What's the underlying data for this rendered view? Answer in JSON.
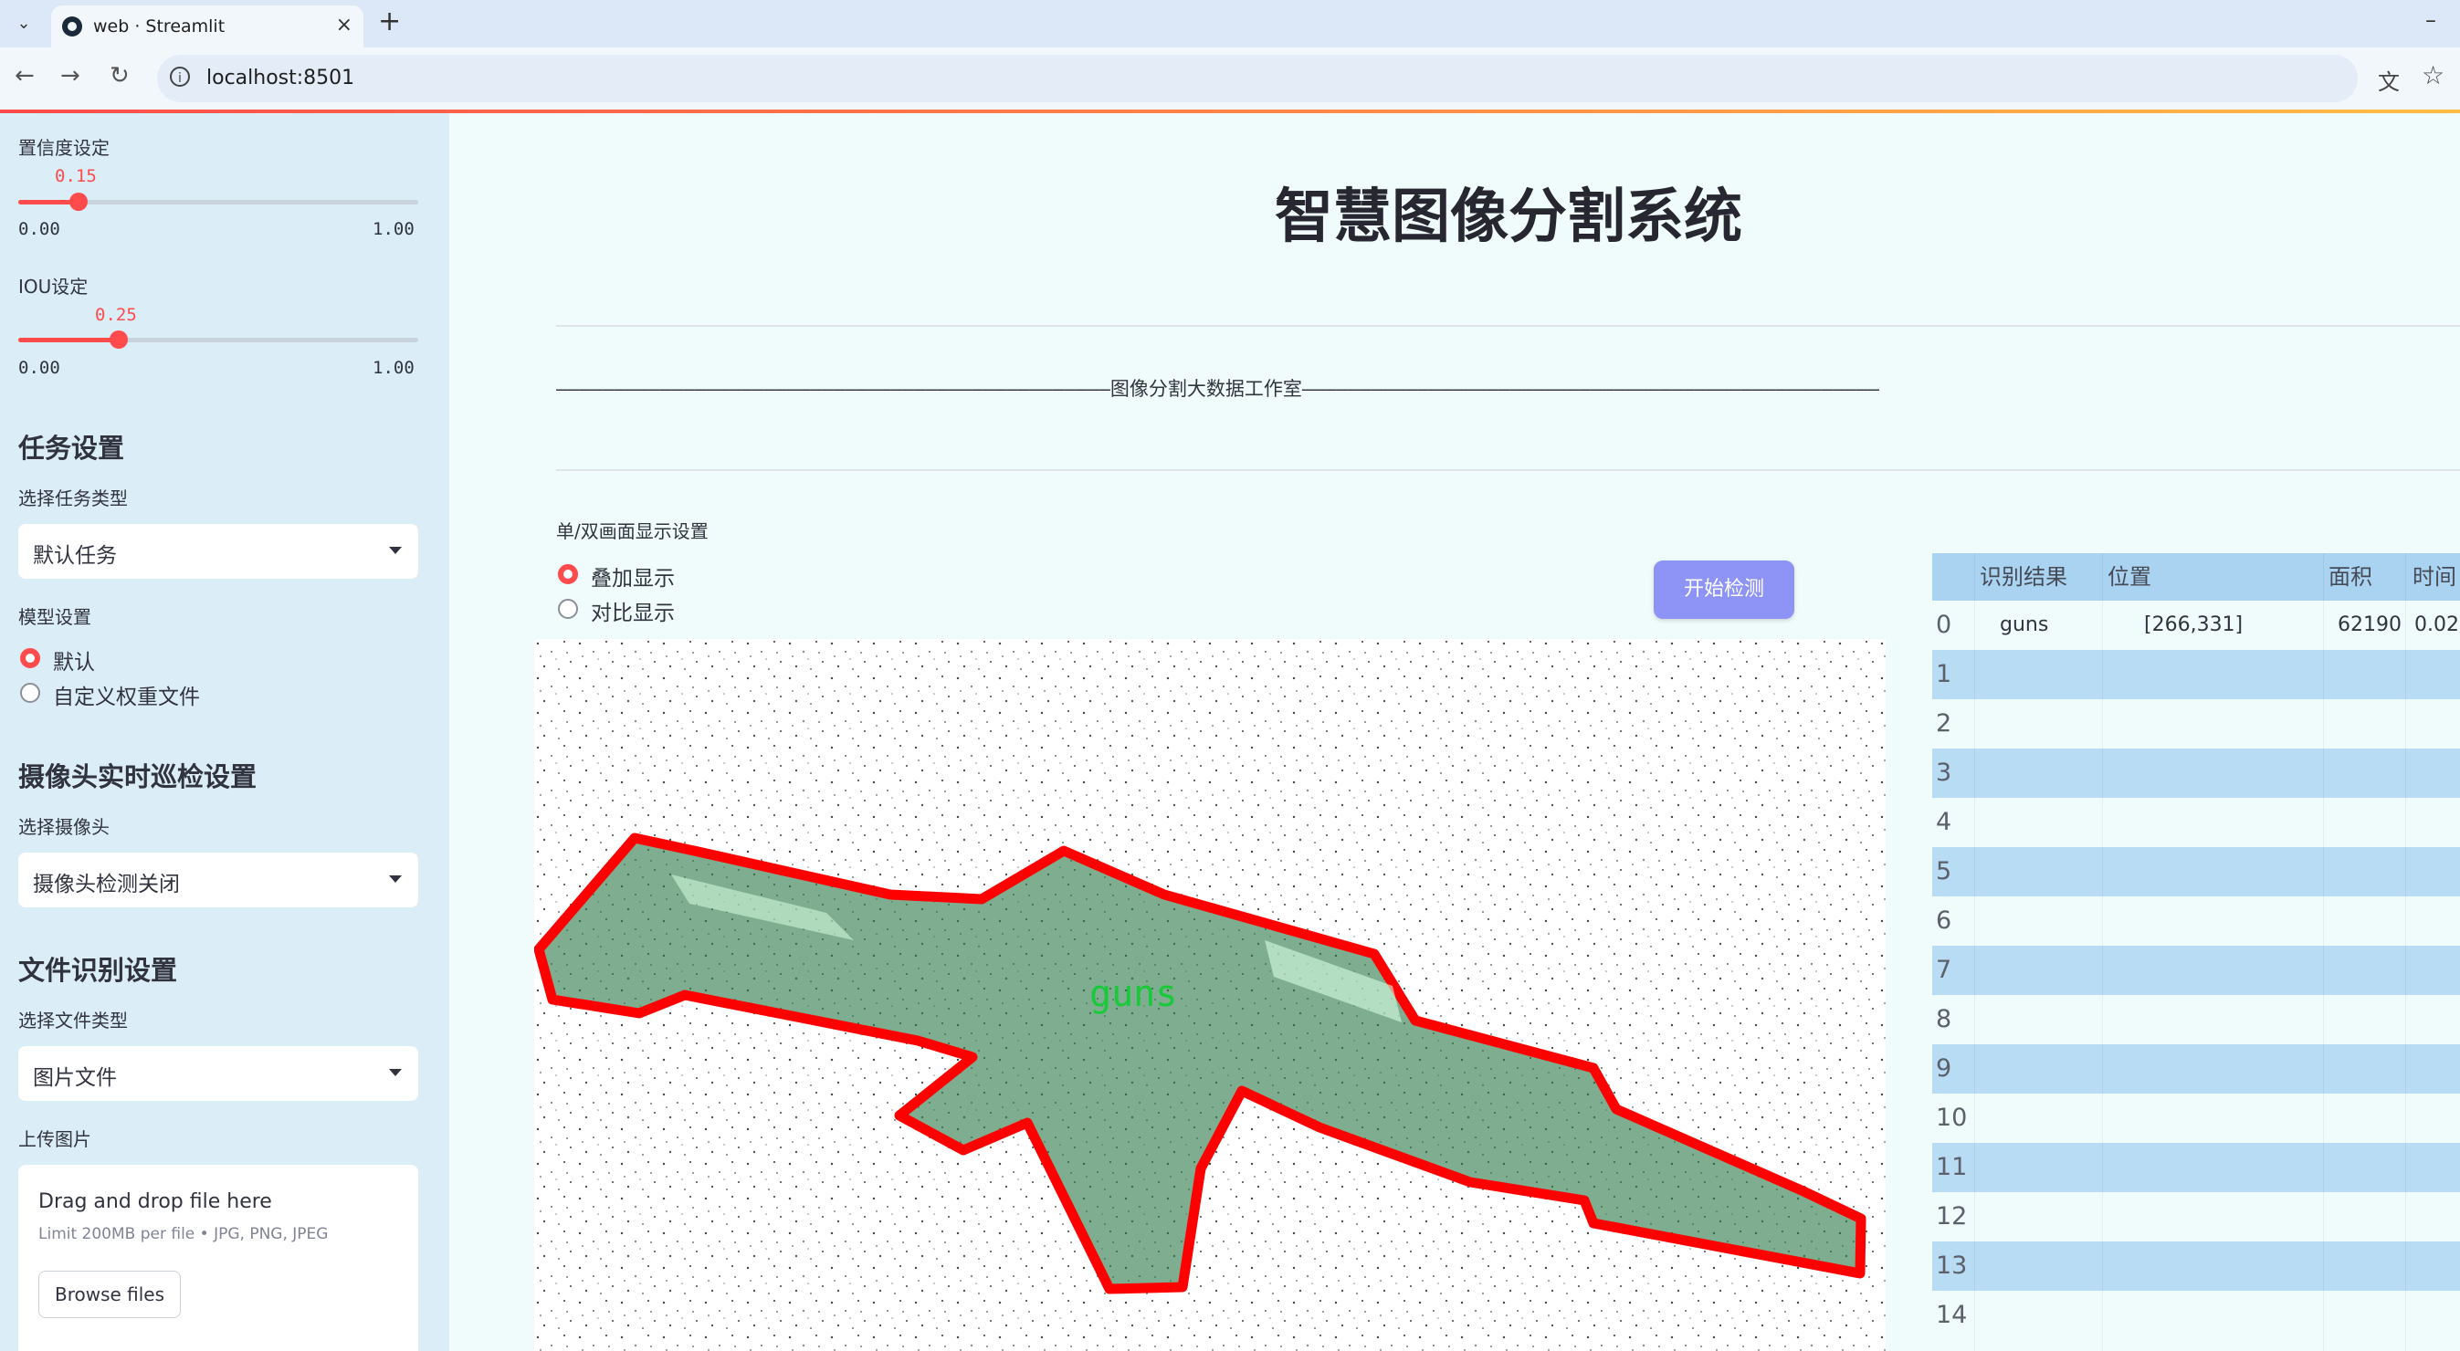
{
  "browser": {
    "tab_title": "web · Streamlit",
    "url": "localhost:8501"
  },
  "sidebar": {
    "confidence": {
      "label": "置信度设定",
      "value_text": "0.15",
      "value": 0.15,
      "min": "0.00",
      "max": "1.00"
    },
    "iou": {
      "label": "IOU设定",
      "value_text": "0.25",
      "value": 0.25,
      "min": "0.00",
      "max": "1.00"
    },
    "task_heading": "任务设置",
    "task_type_label": "选择任务类型",
    "task_type_value": "默认任务",
    "model_label": "模型设置",
    "model_options": [
      {
        "label": "默认",
        "selected": true
      },
      {
        "label": "自定义权重文件",
        "selected": false
      }
    ],
    "camera_heading": "摄像头实时巡检设置",
    "camera_label": "选择摄像头",
    "camera_value": "摄像头检测关闭",
    "file_heading": "文件识别设置",
    "file_type_label": "选择文件类型",
    "file_type_value": "图片文件",
    "upload_label": "上传图片",
    "upload_title": "Drag and drop file here",
    "upload_hint": "Limit 200MB per file • JPG, PNG, JPEG",
    "browse_label": "Browse files"
  },
  "main": {
    "title": "智慧图像分割系统",
    "banner": "————————————————————————————————————————————————图像分割大数据工作室——————————————————————————————————————————————————",
    "display_label": "单/双画面显示设置",
    "display_options": [
      {
        "label": "叠加显示",
        "selected": true
      },
      {
        "label": "对比显示",
        "selected": false
      }
    ],
    "start_button": "开始检测",
    "detection_label": "guns"
  },
  "table": {
    "columns": [
      "识别结果",
      "位置",
      "面积",
      "时间"
    ],
    "rows": [
      {
        "index": "0",
        "result": "guns",
        "position": "[266,331]",
        "area": "62190",
        "time": "0.02"
      },
      {
        "index": "1",
        "result": "",
        "position": "",
        "area": "",
        "time": ""
      },
      {
        "index": "2",
        "result": "",
        "position": "",
        "area": "",
        "time": ""
      },
      {
        "index": "3",
        "result": "",
        "position": "",
        "area": "",
        "time": ""
      },
      {
        "index": "4",
        "result": "",
        "position": "",
        "area": "",
        "time": ""
      },
      {
        "index": "5",
        "result": "",
        "position": "",
        "area": "",
        "time": ""
      },
      {
        "index": "6",
        "result": "",
        "position": "",
        "area": "",
        "time": ""
      },
      {
        "index": "7",
        "result": "",
        "position": "",
        "area": "",
        "time": ""
      },
      {
        "index": "8",
        "result": "",
        "position": "",
        "area": "",
        "time": ""
      },
      {
        "index": "9",
        "result": "",
        "position": "",
        "area": "",
        "time": ""
      },
      {
        "index": "10",
        "result": "",
        "position": "",
        "area": "",
        "time": ""
      },
      {
        "index": "11",
        "result": "",
        "position": "",
        "area": "",
        "time": ""
      },
      {
        "index": "12",
        "result": "",
        "position": "",
        "area": "",
        "time": ""
      },
      {
        "index": "13",
        "result": "",
        "position": "",
        "area": "",
        "time": ""
      },
      {
        "index": "14",
        "result": "",
        "position": "",
        "area": "",
        "time": ""
      }
    ]
  },
  "colors": {
    "accent": "#ff4b4b",
    "sidebar_bg": "#dbeef8",
    "button": "#8d94f5",
    "mask": "#2f7a4a",
    "outline": "#ff0000"
  }
}
